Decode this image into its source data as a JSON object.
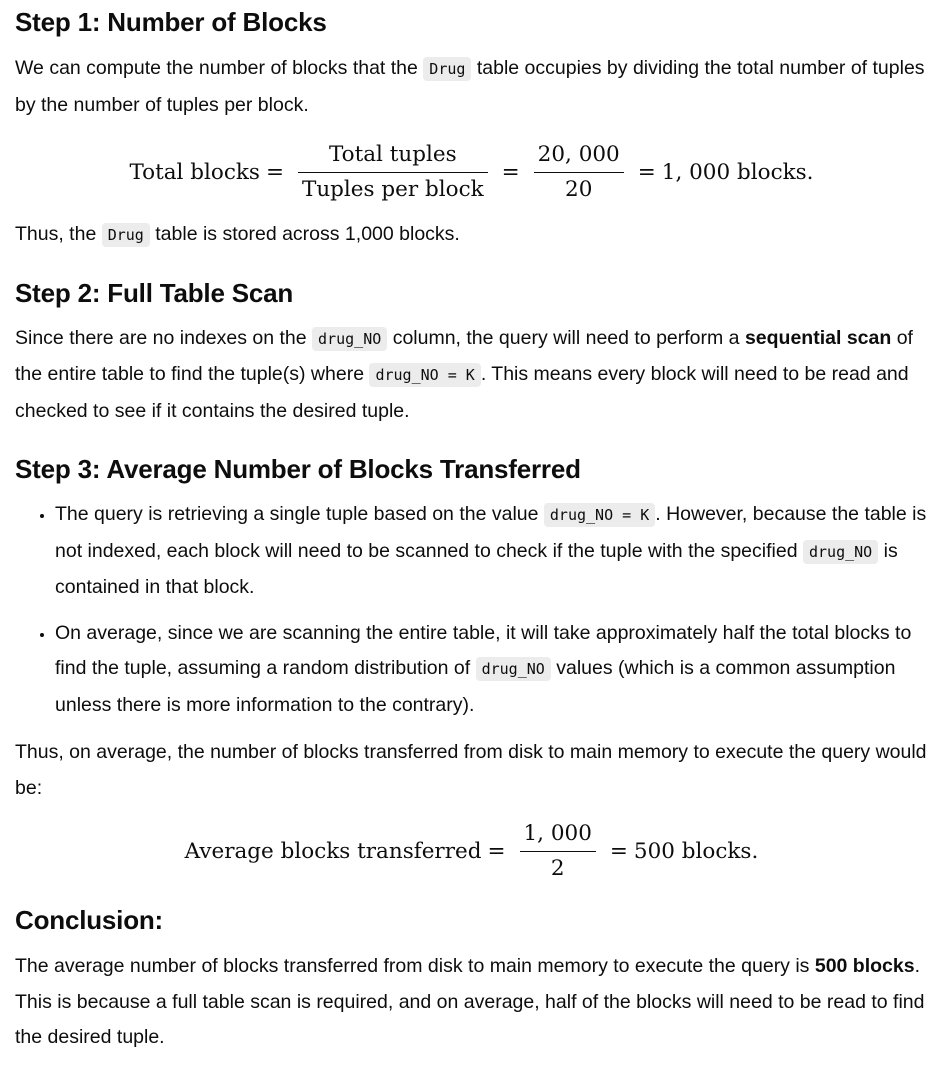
{
  "step1": {
    "heading": "Step 1: Number of Blocks",
    "p1_a": "We can compute the number of blocks that the",
    "p1_code": "Drug",
    "p1_b": "table occupies by dividing the total number of tuples by the number of tuples per block.",
    "eq_lhs": "Total blocks",
    "eq_eq1": "=",
    "eq_frac1_num": "Total tuples",
    "eq_frac1_den": "Tuples per block",
    "eq_eq2": "=",
    "eq_frac2_num": "20, 000",
    "eq_frac2_den": "20",
    "eq_eq3": "=",
    "eq_rhs": "1, 000 blocks.",
    "p2_a": "Thus, the",
    "p2_code": "Drug",
    "p2_b": "table is stored across 1,000 blocks."
  },
  "step2": {
    "heading": "Step 2: Full Table Scan",
    "p_a": "Since there are no indexes on the",
    "p_code1": "drug_NO",
    "p_b": "column, the query will need to perform a",
    "p_strong": "sequential scan",
    "p_c": "of the entire table to find the tuple(s) where",
    "p_code2": "drug_NO = K",
    "p_d": ". This means every block will need to be read and checked to see if it contains the desired tuple."
  },
  "step3": {
    "heading": "Step 3: Average Number of Blocks Transferred",
    "bullets": [
      {
        "a": "The query is retrieving a single tuple based on the value",
        "code1": "drug_NO = K",
        "b": ". However, because the table is not indexed, each block will need to be scanned to check if the tuple with the specified",
        "code2": "drug_NO",
        "c": "is contained in that block."
      },
      {
        "a": "On average, since we are scanning the entire table, it will take approximately half the total blocks to find the tuple, assuming a random distribution of",
        "code1": "drug_NO",
        "b": "values (which is a common assumption unless there is more information to the contrary)."
      }
    ],
    "p_after": "Thus, on average, the number of blocks transferred from disk to main memory to execute the query would be:",
    "eq_lhs": "Average blocks transferred",
    "eq_eq1": "=",
    "eq_frac_num": "1, 000",
    "eq_frac_den": "2",
    "eq_eq2": "=",
    "eq_rhs": "500 blocks."
  },
  "conclusion": {
    "heading": "Conclusion:",
    "p_a": "The average number of blocks transferred from disk to main memory to execute the query is",
    "p_strong": "500 blocks",
    "p_b": ". This is because a full table scan is required, and on average, half of the blocks will need to be read to find the desired tuple."
  }
}
